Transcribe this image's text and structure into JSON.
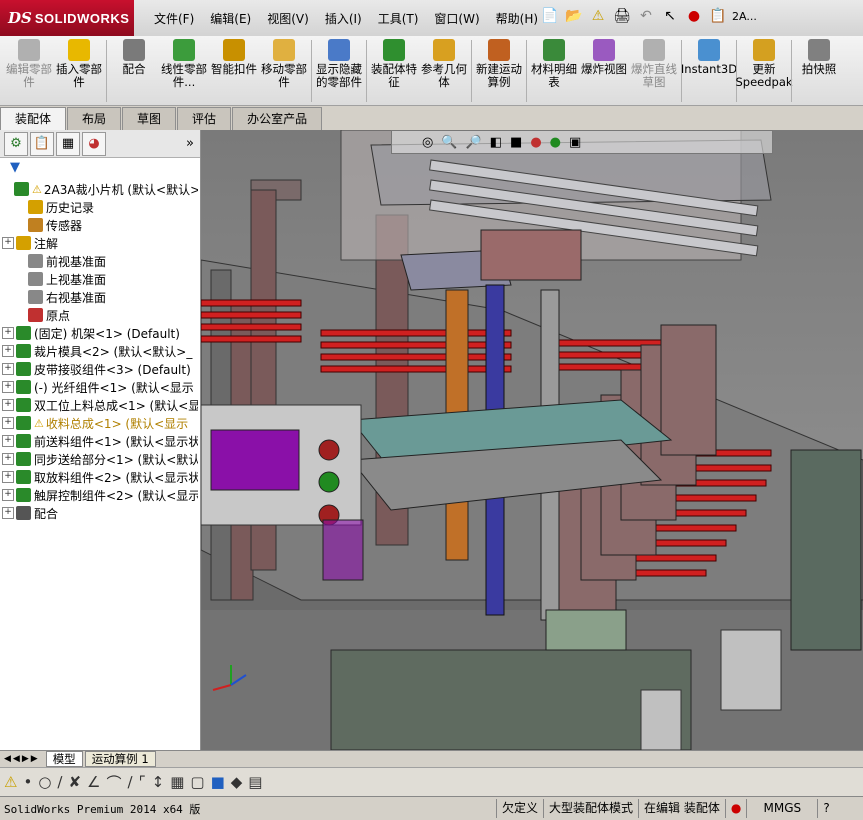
{
  "app": {
    "logo_ds": "DS",
    "logo_name": "SOLIDWORKS"
  },
  "menus": [
    "文件(F)",
    "编辑(E)",
    "视图(V)",
    "插入(I)",
    "工具(T)",
    "窗口(W)",
    "帮助(H)"
  ],
  "quickbar": {
    "doc_label": "2A..."
  },
  "ribbon": {
    "buttons": [
      {
        "label": "编辑零部件",
        "disabled": true,
        "icon": "edit-component-icon",
        "color": "#b0b0b0"
      },
      {
        "label": "插入零部件",
        "disabled": false,
        "icon": "insert-component-icon",
        "color": "#e8b800"
      },
      {
        "label": "配合",
        "disabled": false,
        "icon": "mate-icon",
        "color": "#7a7a7a"
      },
      {
        "label": "线性零部件...",
        "disabled": false,
        "icon": "linear-pattern-icon",
        "color": "#3c9c3c"
      },
      {
        "label": "智能扣件",
        "disabled": false,
        "icon": "smart-fasteners-icon",
        "color": "#c89000"
      },
      {
        "label": "移动零部件",
        "disabled": false,
        "icon": "move-component-icon",
        "color": "#e0b040"
      },
      {
        "label": "显示隐藏的零部件",
        "disabled": false,
        "icon": "show-hidden-icon",
        "color": "#4a7ac8"
      },
      {
        "label": "装配体特征",
        "disabled": false,
        "icon": "assembly-features-icon",
        "color": "#2f8f2f"
      },
      {
        "label": "参考几何体",
        "disabled": false,
        "icon": "reference-geometry-icon",
        "color": "#d8a020"
      },
      {
        "label": "新建运动算例",
        "disabled": false,
        "icon": "motion-study-icon",
        "color": "#c06020"
      },
      {
        "label": "材料明细表",
        "disabled": false,
        "icon": "bom-icon",
        "color": "#3a8a3a"
      },
      {
        "label": "爆炸视图",
        "disabled": false,
        "icon": "exploded-view-icon",
        "color": "#9a5ac0"
      },
      {
        "label": "爆炸直线草图",
        "disabled": true,
        "icon": "explode-line-icon",
        "color": "#b0b0b0"
      },
      {
        "label": "Instant3D",
        "disabled": false,
        "icon": "instant3d-icon",
        "color": "#4a90d0"
      },
      {
        "label": "更新Speedpak",
        "disabled": false,
        "icon": "speedpak-icon",
        "color": "#d4a020"
      },
      {
        "label": "拍快照",
        "disabled": false,
        "icon": "snapshot-icon",
        "color": "#808080"
      }
    ]
  },
  "cmd_tabs": [
    {
      "label": "装配体",
      "active": true
    },
    {
      "label": "布局",
      "active": false
    },
    {
      "label": "草图",
      "active": false
    },
    {
      "label": "评估",
      "active": false
    },
    {
      "label": "办公室产品",
      "active": false
    }
  ],
  "tree": [
    {
      "label": "2A3A裁小片机 (默认<默认>",
      "expand": "",
      "icon": "assembly-icon",
      "warn": true,
      "indent": 0
    },
    {
      "label": "历史记录",
      "expand": "",
      "icon": "history-icon",
      "warn": false,
      "indent": 1
    },
    {
      "label": "传感器",
      "expand": "",
      "icon": "sensor-icon",
      "warn": false,
      "indent": 1
    },
    {
      "label": "注解",
      "expand": "+",
      "icon": "annotation-icon",
      "warn": false,
      "indent": 0
    },
    {
      "label": "前视基准面",
      "expand": "",
      "icon": "plane-icon",
      "warn": false,
      "indent": 1
    },
    {
      "label": "上视基准面",
      "expand": "",
      "icon": "plane-icon",
      "warn": false,
      "indent": 1
    },
    {
      "label": "右视基准面",
      "expand": "",
      "icon": "plane-icon",
      "warn": false,
      "indent": 1
    },
    {
      "label": "原点",
      "expand": "",
      "icon": "origin-icon",
      "warn": false,
      "indent": 1
    },
    {
      "label": "(固定) 机架<1> (Default)",
      "expand": "+",
      "icon": "subassembly-icon",
      "warn": false,
      "indent": 0
    },
    {
      "label": "裁片模具<2> (默认<默认>_",
      "expand": "+",
      "icon": "subassembly-icon",
      "warn": false,
      "indent": 0
    },
    {
      "label": "皮带接驳组件<3> (Default)",
      "expand": "+",
      "icon": "subassembly-icon",
      "warn": false,
      "indent": 0
    },
    {
      "label": "(-) 光纤组件<1> (默认<显示",
      "expand": "+",
      "icon": "subassembly-icon",
      "warn": false,
      "indent": 0
    },
    {
      "label": "双工位上料总成<1> (默认<显",
      "expand": "+",
      "icon": "subassembly-icon",
      "warn": false,
      "indent": 0
    },
    {
      "label": "收料总成<1> (默认<显示",
      "expand": "+",
      "icon": "subassembly-icon",
      "warn": true,
      "indent": 0
    },
    {
      "label": "前送料组件<1> (默认<显示状",
      "expand": "+",
      "icon": "subassembly-icon",
      "warn": false,
      "indent": 0
    },
    {
      "label": "同步送给部分<1> (默认<默认",
      "expand": "+",
      "icon": "subassembly-icon",
      "warn": false,
      "indent": 0
    },
    {
      "label": "取放料组件<2> (默认<显示状",
      "expand": "+",
      "icon": "subassembly-icon",
      "warn": false,
      "indent": 0
    },
    {
      "label": "触屏控制组件<2> (默认<显示",
      "expand": "+",
      "icon": "subassembly-icon",
      "warn": false,
      "indent": 0
    },
    {
      "label": "配合",
      "expand": "+",
      "icon": "mates-icon",
      "warn": false,
      "indent": 0
    }
  ],
  "bottom_tabs": [
    {
      "label": "模型",
      "active": true
    },
    {
      "label": "运动算例 1",
      "active": false
    }
  ],
  "status": {
    "product": "SolidWorks Premium 2014 x64 版",
    "custom": "欠定义",
    "mode": "大型装配体模式",
    "editing": "在编辑 装配体",
    "units": "MMGS"
  }
}
